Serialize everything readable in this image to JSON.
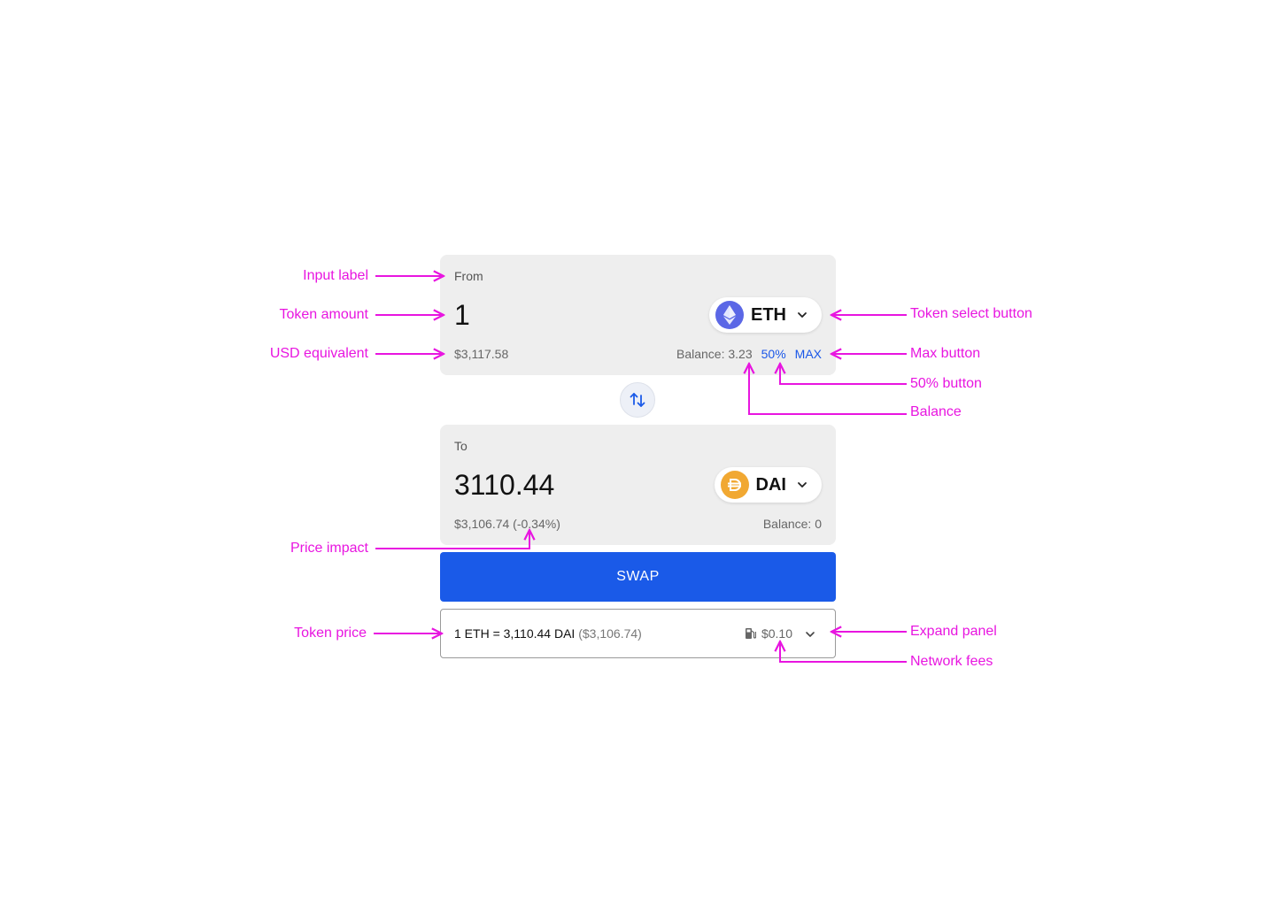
{
  "from": {
    "label": "From",
    "amount": "1",
    "token": "ETH",
    "usd": "$3,117.58",
    "balance": "Balance: 3.23",
    "half_label": "50%",
    "max_label": "MAX"
  },
  "to": {
    "label": "To",
    "amount": "3110.44",
    "token": "DAI",
    "usd": "$3,106.74 (-0.34%)",
    "balance": "Balance: 0"
  },
  "swap_button": "SWAP",
  "info": {
    "price": "1 ETH = 3,110.44 DAI",
    "price_usd": "($3,106.74)",
    "fee": "$0.10"
  },
  "annotations": {
    "input_label": "Input label",
    "token_amount": "Token amount",
    "usd_equivalent": "USD equivalent",
    "price_impact": "Price impact",
    "token_price": "Token price",
    "token_select_button": "Token select button",
    "max_button": "Max button",
    "half_button": "50% button",
    "balance": "Balance",
    "expand_panel": "Expand panel",
    "network_fees": "Network fees"
  },
  "colors": {
    "accent": "#1a5ae8",
    "annotation": "#e815e0",
    "panel_bg": "#eeeeee",
    "eth": "#5b67e6",
    "dai": "#f1a832"
  }
}
